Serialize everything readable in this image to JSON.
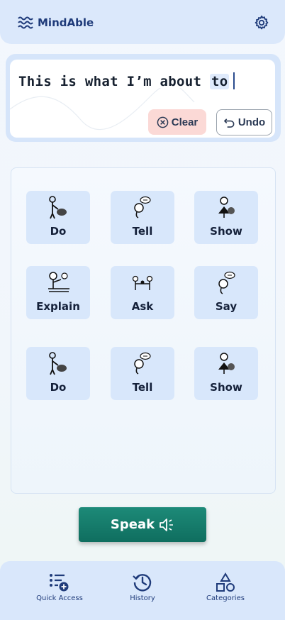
{
  "header": {
    "app_title": "MindAble",
    "logo_icon": "waves-logo-icon",
    "settings_icon": "gear-icon"
  },
  "sentence": {
    "text_before": "This is what I’m about ",
    "highlighted_word": "to"
  },
  "actions": {
    "clear_label": "Clear",
    "undo_label": "Undo"
  },
  "tiles": [
    {
      "label": "Do",
      "icon": "do-pictogram-icon"
    },
    {
      "label": "Tell",
      "icon": "tell-pictogram-icon"
    },
    {
      "label": "Show",
      "icon": "show-pictogram-icon"
    },
    {
      "label": "Explain",
      "icon": "explain-pictogram-icon"
    },
    {
      "label": "Ask",
      "icon": "ask-pictogram-icon"
    },
    {
      "label": "Say",
      "icon": "say-pictogram-icon"
    },
    {
      "label": "Do",
      "icon": "do-pictogram-icon"
    },
    {
      "label": "Tell",
      "icon": "tell-pictogram-icon"
    },
    {
      "label": "Show",
      "icon": "show-pictogram-icon"
    }
  ],
  "speak": {
    "label": "Speak",
    "icon": "speaker-icon"
  },
  "nav": [
    {
      "label": "Quick Access",
      "icon": "quick-access-icon"
    },
    {
      "label": "History",
      "icon": "history-icon"
    },
    {
      "label": "Categories",
      "icon": "categories-icon"
    }
  ],
  "colors": {
    "header_bg": "#dbe8fb",
    "tile_bg": "#d8e7fb",
    "speak_bg": "#137a69",
    "clear_bg": "#fbd9d6",
    "brand_text": "#1f3b7a"
  }
}
